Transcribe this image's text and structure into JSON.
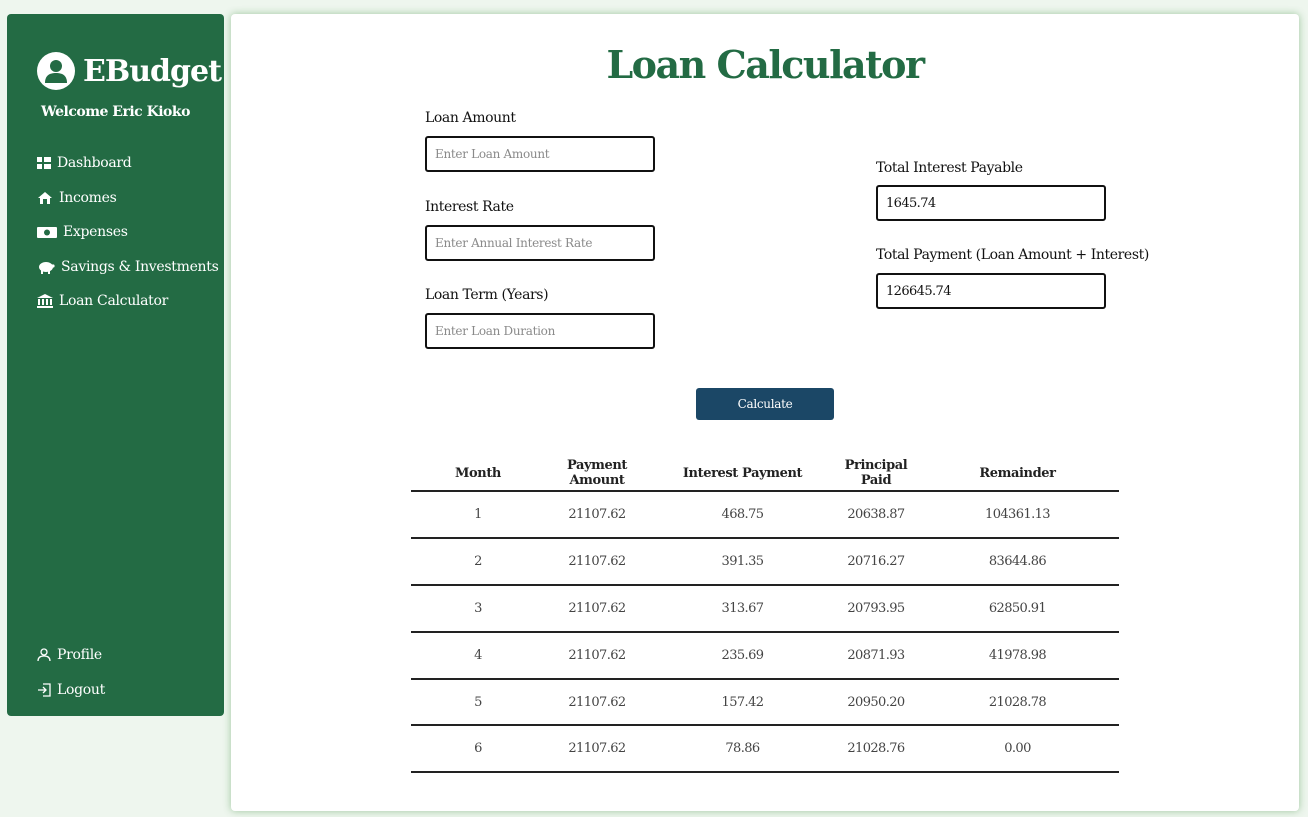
{
  "app": {
    "title": "EBudget",
    "welcome": "Welcome Eric Kioko"
  },
  "sidebar": {
    "items": [
      {
        "label": "Dashboard",
        "icon": "dashboard-icon"
      },
      {
        "label": "Incomes",
        "icon": "income-icon"
      },
      {
        "label": "Expenses",
        "icon": "money-icon"
      },
      {
        "label": "Savings & Investments",
        "icon": "piggy-bank-icon"
      },
      {
        "label": "Loan Calculator",
        "icon": "bank-icon"
      }
    ],
    "bottom_items": [
      {
        "label": "Profile",
        "icon": "user-icon"
      },
      {
        "label": "Logout",
        "icon": "logout-icon"
      }
    ]
  },
  "colors": {
    "sidebar_bg": "#236b44",
    "title_color": "#236b44",
    "button_bg": "#1b4766",
    "page_bg": "#eef6ee"
  },
  "main": {
    "title": "Loan Calculator",
    "loan_amount": {
      "label": "Loan Amount",
      "placeholder": "Enter Loan Amount",
      "value": ""
    },
    "interest_rate": {
      "label": "Interest Rate",
      "placeholder": "Enter Annual Interest Rate",
      "value": ""
    },
    "loan_term": {
      "label": "Loan Term (Years)",
      "placeholder": "Enter Loan Duration",
      "value": ""
    },
    "total_interest": {
      "label": "Total Interest Payable",
      "value": "1645.74"
    },
    "total_payment": {
      "label": "Total Payment (Loan Amount + Interest)",
      "value": "126645.74"
    },
    "calculate_label": "Calculate"
  },
  "table": {
    "headers": [
      "Month",
      "Payment Amount",
      "Interest Payment",
      "Principal Paid",
      "Remainder"
    ],
    "rows": [
      [
        "1",
        "21107.62",
        "468.75",
        "20638.87",
        "104361.13"
      ],
      [
        "2",
        "21107.62",
        "391.35",
        "20716.27",
        "83644.86"
      ],
      [
        "3",
        "21107.62",
        "313.67",
        "20793.95",
        "62850.91"
      ],
      [
        "4",
        "21107.62",
        "235.69",
        "20871.93",
        "41978.98"
      ],
      [
        "5",
        "21107.62",
        "157.42",
        "20950.20",
        "21028.78"
      ],
      [
        "6",
        "21107.62",
        "78.86",
        "21028.76",
        "0.00"
      ]
    ]
  }
}
